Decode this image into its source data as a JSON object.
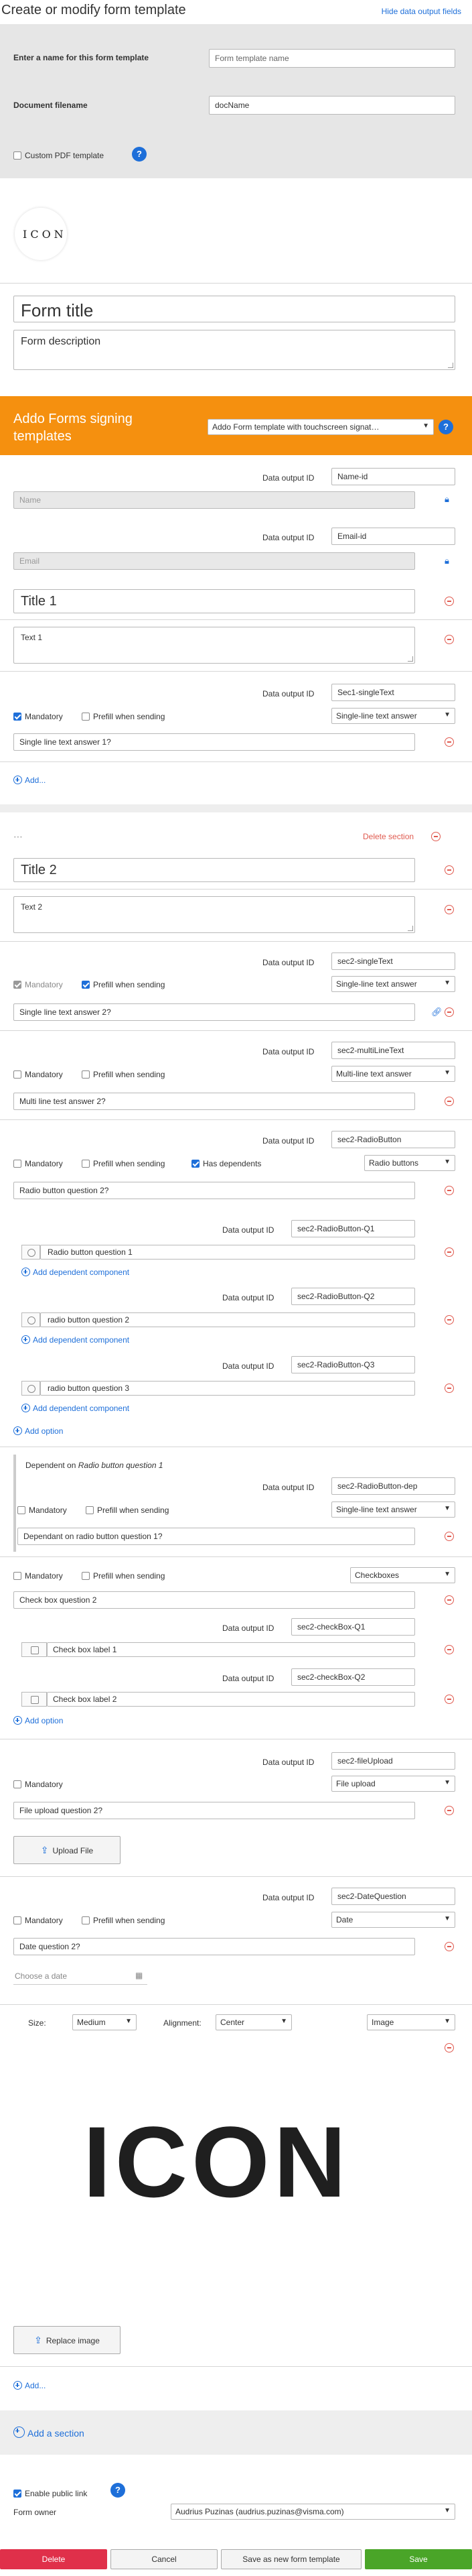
{
  "page": {
    "title": "Create or modify form template",
    "hide_fields_link": "Hide data output fields"
  },
  "settings": {
    "template_name_label": "Enter a name for this form template",
    "template_name_placeholder": "Form template name",
    "doc_filename_label": "Document filename",
    "doc_filename_value": "docName",
    "custom_pdf_label": "Custom PDF template"
  },
  "logo_small_text": "ICON",
  "form": {
    "title_placeholder": "Form title",
    "description_placeholder": "Form description"
  },
  "signing": {
    "header": "Addo Forms signing templates",
    "select_value": "Addo Form template with touchscreen signat…",
    "name_data_id": "Name-id",
    "name_placeholder": "Name",
    "email_data_id": "Email-id",
    "email_placeholder": "Email"
  },
  "labels": {
    "data_output_id": "Data output ID",
    "mandatory": "Mandatory",
    "prefill": "Prefill when sending",
    "has_dependents": "Has dependents",
    "add": "Add...",
    "add_option": "Add option",
    "add_dependent": "Add dependent component",
    "delete_section": "Delete section",
    "dependent_on_prefix": "Dependent on ",
    "dependent_on_target": "Radio button question 1",
    "upload_file": "Upload File",
    "choose_date": "Choose a date",
    "replace_image": "Replace image",
    "add_section": "Add a section",
    "size": "Size:",
    "alignment": "Alignment:"
  },
  "section1": {
    "title": "Title 1",
    "text": "Text 1",
    "q_data_id": "Sec1-singleText",
    "q_type": "Single-line text answer",
    "q_text": "Single line text answer 1?"
  },
  "section2": {
    "title": "Title 2",
    "text": "Text 2",
    "single": {
      "data_id": "sec2-singleText",
      "type": "Single-line text answer",
      "text": "Single line text answer 2?"
    },
    "multi": {
      "data_id": "sec2-multiLineText",
      "type": "Multi-line text answer",
      "text": "Multi line test answer 2?"
    },
    "radio": {
      "data_id": "sec2-RadioButton",
      "type": "Radio buttons",
      "text": "Radio button question 2?",
      "options": [
        {
          "data_id": "sec2-RadioButton-Q1",
          "label": "Radio button question 1"
        },
        {
          "data_id": "sec2-RadioButton-Q2",
          "label": "radio button question 2"
        },
        {
          "data_id": "sec2-RadioButton-Q3",
          "label": "radio button question 3"
        }
      ]
    },
    "dependent": {
      "data_id": "sec2-RadioButton-dep",
      "type": "Single-line text answer",
      "text": "Dependant on radio button question 1?"
    },
    "checkboxes": {
      "type": "Checkboxes",
      "text": "Check box question 2",
      "options": [
        {
          "data_id": "sec2-checkBox-Q1",
          "label": "Check box label 1"
        },
        {
          "data_id": "sec2-checkBox-Q2",
          "label": "Check box label 2"
        }
      ]
    },
    "upload": {
      "data_id": "sec2-fileUpload",
      "type": "File upload",
      "text": "File upload question 2?"
    },
    "date": {
      "data_id": "sec2-DateQuestion",
      "type": "Date",
      "text": "Date question 2?"
    },
    "image": {
      "size": "Medium",
      "alignment": "Center",
      "type": "Image",
      "logo_text": "ICON"
    }
  },
  "footer": {
    "public_link_label": "Enable public link",
    "form_owner_label": "Form owner",
    "form_owner_value": "Audrius Puzinas (audrius.puzinas@visma.com)",
    "delete": "Delete",
    "cancel": "Cancel",
    "save_as_new": "Save as new form template",
    "save": "Save"
  },
  "colors": {
    "orange": "#f5900f",
    "blue": "#1e6fd9",
    "red": "#e0304a",
    "green": "#4aa528",
    "gray_panel": "#e6e6e6"
  }
}
